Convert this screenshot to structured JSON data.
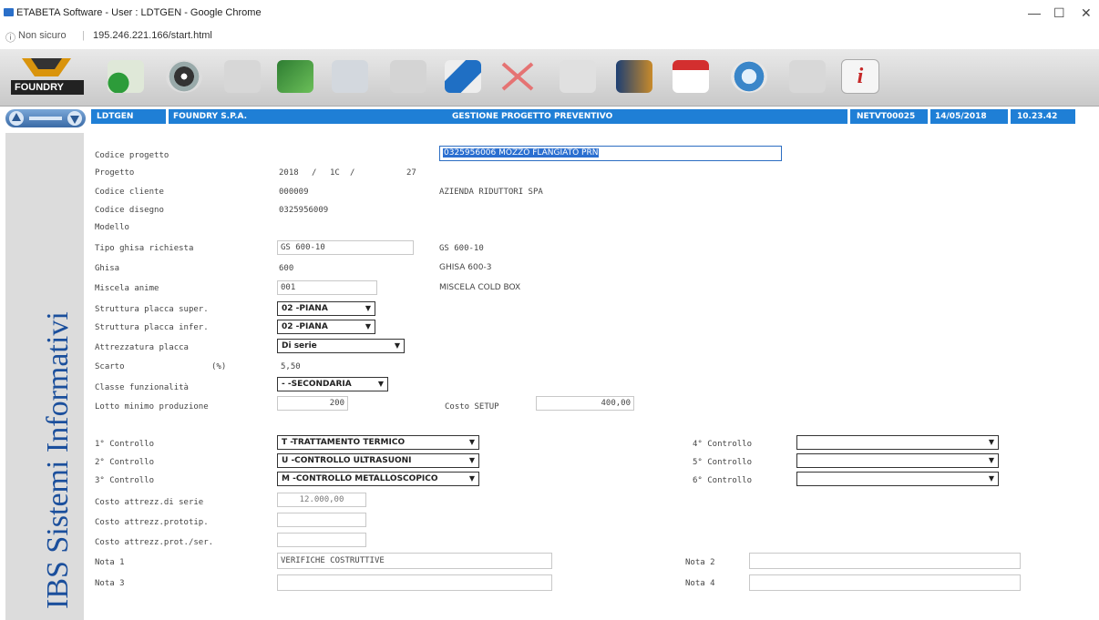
{
  "browser": {
    "window_title": "ETABETA Software - User : LDTGEN - Google Chrome",
    "security": "Non sicuro",
    "url": "195.246.221.166/start.html"
  },
  "toolbar": {
    "logo_text": "FOUNDRY",
    "icons": [
      "foundry-logo-icon",
      "plug-icon",
      "cd-icon",
      "document-icon",
      "exit-icon",
      "doc-icon",
      "calculator-icon",
      "search-tag-icon",
      "close-x-icon",
      "text-icon",
      "door-icon",
      "pdf-icon",
      "refresh-icon",
      "keyboard-icon",
      "info-icon"
    ]
  },
  "header": {
    "user": "LDTGEN",
    "company": "FOUNDRY S.P.A.",
    "title": "GESTIONE PROGETTO PREVENTIVO",
    "program": "NETVT00025",
    "date": "14/05/2018",
    "time": "10.23.42"
  },
  "brand": {
    "text": "IBS Sistemi Informativi"
  },
  "form": {
    "codice_progetto_label": "Codice progetto",
    "codice_progetto_value": "0325956006 MOZZO FLANGIATO PRN",
    "progetto_label": "Progetto",
    "progetto_anno": "2018",
    "progetto_sep1": "/",
    "progetto_tipo": "1C",
    "progetto_sep2": "/",
    "progetto_num": "27",
    "codice_cliente_label": "Codice cliente",
    "codice_cliente_value": "000009",
    "cliente_nome": "AZIENDA RIDUTTORI SPA",
    "codice_disegno_label": "Codice disegno",
    "codice_disegno_value": "0325956009",
    "modello_label": "Modello",
    "tipo_ghisa_label": "Tipo ghisa richiesta",
    "tipo_ghisa_value": "GS 600-10",
    "tipo_ghisa_desc": "GS 600-10",
    "ghisa_label": "Ghisa",
    "ghisa_value": "600",
    "ghisa_desc": "GHISA 600-3",
    "miscela_label": "Miscela anime",
    "miscela_value": "001",
    "miscela_desc": "MISCELA COLD BOX",
    "struttura_super_label": "Struttura placca super.",
    "struttura_super_value": "02 -PIANA",
    "struttura_infer_label": "Struttura placca infer.",
    "struttura_infer_value": "02 -PIANA",
    "attrezzatura_label": "Attrezzatura  placca",
    "attrezzatura_value": "Di serie",
    "scarto_label": "Scarto",
    "scarto_unit": "(%)",
    "scarto_value": "5,50",
    "classe_label": "Classe funzionalità",
    "classe_value": "- -SECONDARIA",
    "lotto_label": "Lotto minimo produzione",
    "lotto_value": "200",
    "costo_setup_label": "Costo SETUP",
    "costo_setup_value": "400,00",
    "controllo1_label": "1° Controllo",
    "controllo1_value": "T -TRATTAMENTO TERMICO",
    "controllo2_label": "2° Controllo",
    "controllo2_value": "U -CONTROLLO ULTRASUONI",
    "controllo3_label": "3° Controllo",
    "controllo3_value": "M -CONTROLLO METALLOSCOPICO",
    "controllo4_label": "4° Controllo",
    "controllo5_label": "5° Controllo",
    "controllo6_label": "6° Controllo",
    "costo_serie_label": "Costo attrezz.di serie",
    "costo_serie_value": "12.000,00",
    "costo_prototip_label": "Costo attrezz.prototip.",
    "costo_protser_label": "Costo attrezz.prot./ser.",
    "nota1_label": "Nota 1",
    "nota1_value": "VERIFICHE COSTRUTTIVE",
    "nota2_label": "Nota 2",
    "nota3_label": "Nota 3",
    "nota4_label": "Nota 4",
    "dropdown_arrow": "▼"
  }
}
